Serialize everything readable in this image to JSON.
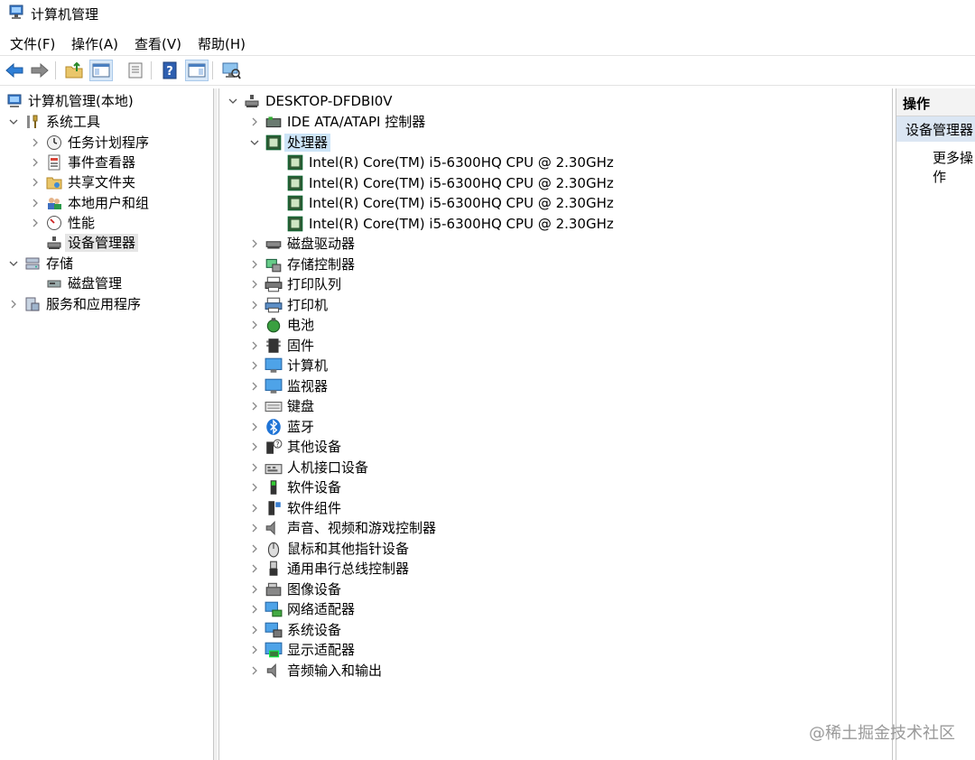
{
  "window": {
    "title": "计算机管理"
  },
  "menu": [
    {
      "label": "文件(F)"
    },
    {
      "label": "操作(A)"
    },
    {
      "label": "查看(V)"
    },
    {
      "label": "帮助(H)"
    }
  ],
  "toolbar": {
    "buttons": [
      {
        "icon": "back-arrow-icon"
      },
      {
        "icon": "forward-arrow-icon"
      },
      {
        "icon": "up-folder-icon"
      },
      {
        "icon": "show-hide-console-tree-icon",
        "active": true
      },
      {
        "icon": "properties-icon"
      },
      {
        "icon": "help-icon"
      },
      {
        "icon": "show-action-pane-icon",
        "active": true
      },
      {
        "icon": "scan-hardware-icon"
      }
    ]
  },
  "left_tree": {
    "root": "计算机管理(本地)",
    "system_tools": "系统工具",
    "task_scheduler": "任务计划程序",
    "event_viewer": "事件查看器",
    "shared_folders": "共享文件夹",
    "local_users": "本地用户和组",
    "performance": "性能",
    "device_manager": "设备管理器",
    "storage": "存储",
    "disk_management": "磁盘管理",
    "services_apps": "服务和应用程序"
  },
  "device_tree": {
    "computer": "DESKTOP-DFDBI0V",
    "categories": [
      {
        "label": "IDE ATA/ATAPI 控制器",
        "icon": "ide-controller-icon"
      },
      {
        "label": "处理器",
        "icon": "processor-icon",
        "expanded": true,
        "children": [
          "Intel(R) Core(TM) i5-6300HQ CPU @ 2.30GHz",
          "Intel(R) Core(TM) i5-6300HQ CPU @ 2.30GHz",
          "Intel(R) Core(TM) i5-6300HQ CPU @ 2.30GHz",
          "Intel(R) Core(TM) i5-6300HQ CPU @ 2.30GHz"
        ]
      },
      {
        "label": "磁盘驱动器",
        "icon": "disk-drive-icon"
      },
      {
        "label": "存储控制器",
        "icon": "storage-controller-icon"
      },
      {
        "label": "打印队列",
        "icon": "print-queue-icon"
      },
      {
        "label": "打印机",
        "icon": "printer-icon"
      },
      {
        "label": "电池",
        "icon": "battery-icon"
      },
      {
        "label": "固件",
        "icon": "firmware-icon"
      },
      {
        "label": "计算机",
        "icon": "computer-icon"
      },
      {
        "label": "监视器",
        "icon": "monitor-icon"
      },
      {
        "label": "键盘",
        "icon": "keyboard-icon"
      },
      {
        "label": "蓝牙",
        "icon": "bluetooth-icon"
      },
      {
        "label": "其他设备",
        "icon": "other-devices-icon"
      },
      {
        "label": "人机接口设备",
        "icon": "hid-icon"
      },
      {
        "label": "软件设备",
        "icon": "software-device-icon"
      },
      {
        "label": "软件组件",
        "icon": "software-component-icon"
      },
      {
        "label": "声音、视频和游戏控制器",
        "icon": "sound-icon"
      },
      {
        "label": "鼠标和其他指针设备",
        "icon": "mouse-icon"
      },
      {
        "label": "通用串行总线控制器",
        "icon": "usb-icon"
      },
      {
        "label": "图像设备",
        "icon": "imaging-device-icon"
      },
      {
        "label": "网络适配器",
        "icon": "network-adapter-icon"
      },
      {
        "label": "系统设备",
        "icon": "system-device-icon"
      },
      {
        "label": "显示适配器",
        "icon": "display-adapter-icon"
      },
      {
        "label": "音频输入和输出",
        "icon": "audio-io-icon"
      }
    ]
  },
  "actions": {
    "header": "操作",
    "device_manager": "设备管理器",
    "more": "更多操作"
  },
  "watermark": "@稀土掘金技术社区",
  "colors": {
    "selection": "#cce4f7",
    "tree_selection": "#e5e5e5",
    "accent": "#1a73c9"
  }
}
